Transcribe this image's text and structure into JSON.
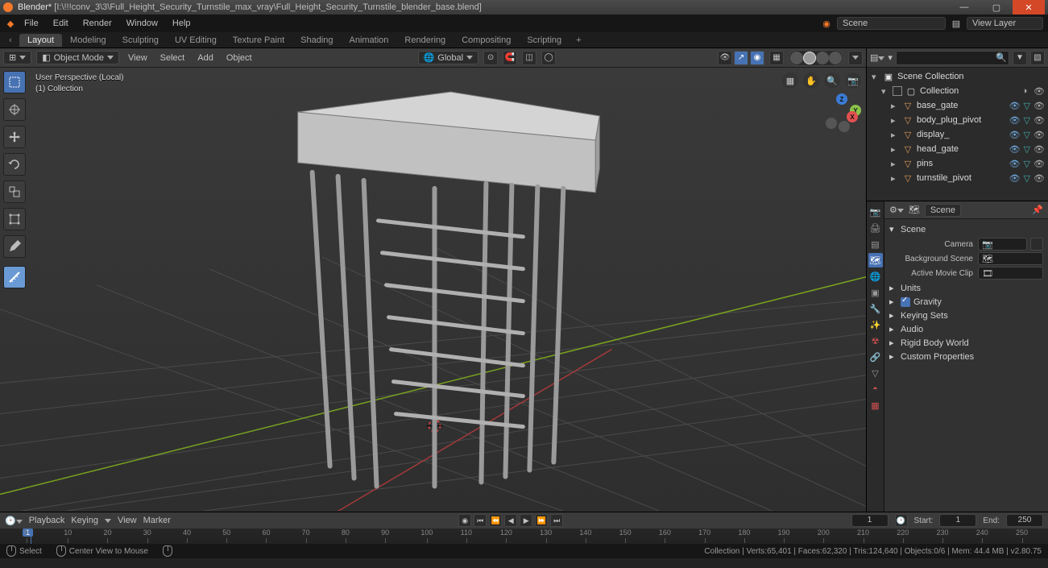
{
  "titlebar": {
    "app": "Blender*",
    "path": "[I:\\!!!conv_3\\3\\Full_Height_Security_Turnstile_max_vray\\Full_Height_Security_Turnstile_blender_base.blend]"
  },
  "menubar": {
    "items": [
      "File",
      "Edit",
      "Render",
      "Window",
      "Help"
    ],
    "scene_label": "Scene",
    "view_layer_label": "View Layer"
  },
  "workspaces": {
    "tabs": [
      "Layout",
      "Modeling",
      "Sculpting",
      "UV Editing",
      "Texture Paint",
      "Shading",
      "Animation",
      "Rendering",
      "Compositing",
      "Scripting"
    ],
    "active": 0
  },
  "viewport_header": {
    "editor_icon": "3dview",
    "mode": "Object Mode",
    "menus": [
      "View",
      "Select",
      "Add",
      "Object"
    ],
    "orientation": "Global"
  },
  "viewport_overlay": {
    "line1": "User Perspective (Local)",
    "line2": "(1) Collection"
  },
  "outliner": {
    "root": "Scene Collection",
    "collection": "Collection",
    "items": [
      "base_gate",
      "body_plug_pivot",
      "display_",
      "head_gate",
      "pins",
      "turnstile_pivot"
    ]
  },
  "properties": {
    "context": "Scene",
    "scene_panel_title": "Scene",
    "rows": {
      "camera": "Camera",
      "bg": "Background Scene",
      "clip": "Active Movie Clip"
    },
    "collapsed": [
      "Units",
      "Gravity",
      "Keying Sets",
      "Audio",
      "Rigid Body World",
      "Custom Properties"
    ],
    "gravity_checked": true
  },
  "timeline": {
    "menus": [
      "Playback",
      "Keying",
      "View",
      "Marker"
    ],
    "current": "1",
    "start_label": "Start:",
    "start": "1",
    "end_label": "End:",
    "end": "250",
    "ticks": [
      "0",
      "10",
      "20",
      "30",
      "40",
      "50",
      "60",
      "70",
      "80",
      "90",
      "100",
      "110",
      "120",
      "130",
      "140",
      "150",
      "160",
      "170",
      "180",
      "190",
      "200",
      "210",
      "220",
      "230",
      "240",
      "250"
    ]
  },
  "status": {
    "left": [
      {
        "label": "Select"
      },
      {
        "label": "Center View to Mouse"
      }
    ],
    "right": "Collection | Verts:65,401 | Faces:62,320 | Tris:124,640 | Objects:0/6 | Mem: 44.4 MB | v2.80.75"
  }
}
